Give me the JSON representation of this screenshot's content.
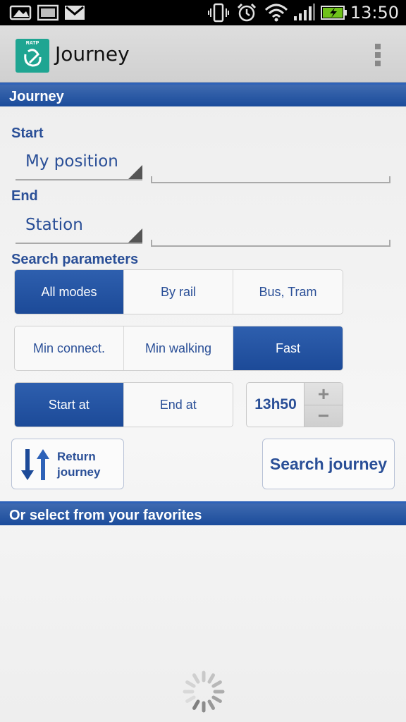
{
  "status_bar": {
    "time": "13:50",
    "icons": [
      "picture-icon",
      "gallery-icon",
      "gmail-icon",
      "vibrate-icon",
      "alarm-icon",
      "wifi-icon",
      "signal-icon",
      "battery-charging-icon"
    ]
  },
  "action_bar": {
    "title": "Journey",
    "logo_text": "RATP",
    "overflow_icon": "overflow-menu-icon"
  },
  "journey_section": {
    "header": "Journey",
    "start_label": "Start",
    "start_value": "My position",
    "start_text": "",
    "end_label": "End",
    "end_value": "Station",
    "end_text": "",
    "params_label": "Search parameters"
  },
  "modes": {
    "options": [
      "All modes",
      "By rail",
      "Bus, Tram"
    ],
    "selected": "All modes"
  },
  "preferences": {
    "options": [
      "Min connect.",
      "Min walking",
      "Fast"
    ],
    "selected": "Fast"
  },
  "time_mode": {
    "options": [
      "Start at",
      "End at"
    ],
    "selected": "Start at",
    "time": "13h50",
    "plus": "+",
    "minus": "−"
  },
  "buttons": {
    "return_label": "Return journey",
    "search_label": "Search journey"
  },
  "favorites": {
    "header": "Or select from your favorites"
  },
  "colors": {
    "accent_blue": "#1c4a98",
    "text_blue": "#2a4f97",
    "logo_green": "#1fa592"
  }
}
